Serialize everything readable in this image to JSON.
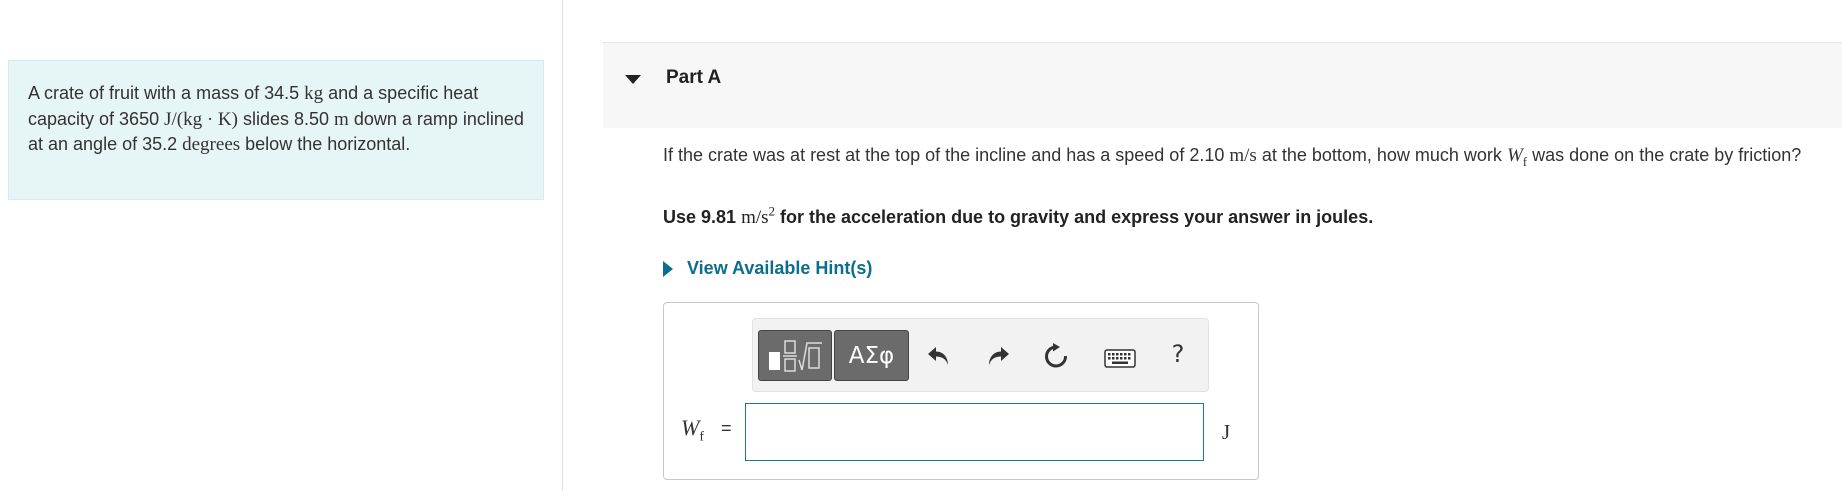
{
  "problem": {
    "t1": "A crate of fruit with a mass of 34.5 ",
    "m1": "kg",
    "t2": " and a specific heat capacity of 3650 ",
    "m2": "J/(kg · K)",
    "t3": " slides 8.50 ",
    "m3": "m",
    "t4": " down a ramp inclined at an angle of 35.2 ",
    "m4": "degrees",
    "t5": " below the horizontal."
  },
  "part": {
    "title": "Part A"
  },
  "question": {
    "t1": "If the crate was at rest at the top of the incline and has a speed of 2.10 ",
    "m1": "m/s",
    "t2": " at the bottom, how much work ",
    "var": "W",
    "var_sub": "f",
    "t3": " was done on the crate by friction?"
  },
  "instruction": {
    "t1": "Use 9.81 ",
    "m1": "m/s",
    "m1_sup": "2",
    "t2": " for the acceleration due to gravity and express your answer in joules."
  },
  "hints": {
    "label": "View Available Hint(s)"
  },
  "toolbar": {
    "symbols_label": "ΑΣφ",
    "help_label": "?"
  },
  "answer": {
    "var": "W",
    "var_sub": "f",
    "equals": "=",
    "value": "",
    "unit": "J"
  }
}
